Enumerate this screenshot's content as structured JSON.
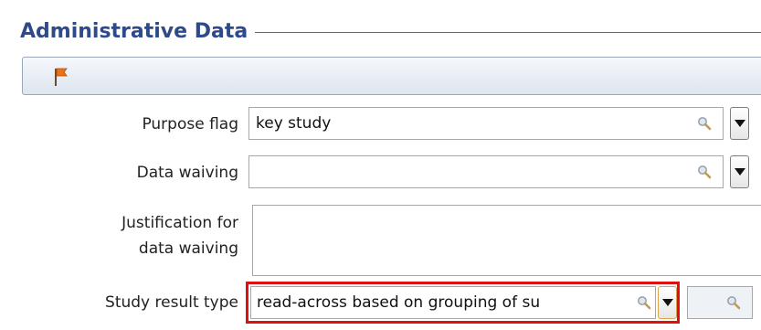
{
  "section": {
    "title": "Administrative Data"
  },
  "toolbar": {
    "icon": "flag-icon"
  },
  "fields": {
    "purpose_flag": {
      "label": "Purpose flag",
      "value": "key study"
    },
    "data_waiving": {
      "label": "Data waiving",
      "value": ""
    },
    "justification": {
      "label_line1": "Justification for",
      "label_line2": "data waiving",
      "value": ""
    },
    "study_result_type": {
      "label": "Study result type",
      "value": "read-across based on grouping of su"
    }
  },
  "colors": {
    "title": "#2e4a8a",
    "highlight": "#e01010",
    "flag": "#e8731a"
  }
}
